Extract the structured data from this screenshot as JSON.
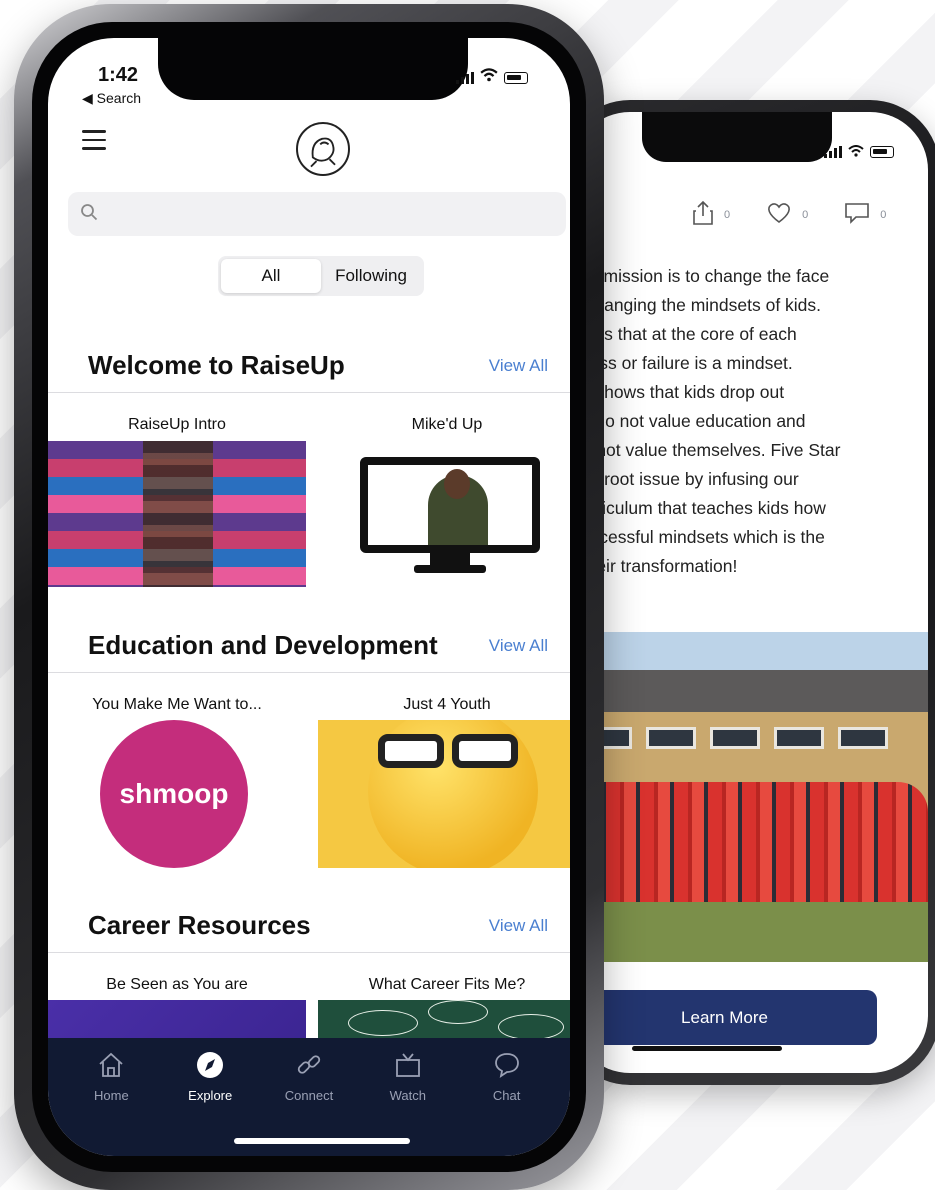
{
  "front": {
    "status": {
      "time": "1:42",
      "back_label": "◀ Search"
    },
    "search": {
      "placeholder": ""
    },
    "segmented": {
      "all": "All",
      "following": "Following"
    },
    "sections": [
      {
        "title": "Welcome to RaiseUp",
        "view_all": "View All",
        "items": [
          {
            "label": "RaiseUp Intro"
          },
          {
            "label": "Mike'd Up"
          }
        ]
      },
      {
        "title": "Education and Development",
        "view_all": "View All",
        "items": [
          {
            "label": "You Make Me Want to..."
          },
          {
            "label": "Just 4 Youth"
          }
        ]
      },
      {
        "title": "Career Resources",
        "view_all": "View All",
        "items": [
          {
            "label": "Be Seen as You are"
          },
          {
            "label": "What Career Fits Me?"
          }
        ]
      }
    ],
    "thumb_text": {
      "shmoop": "shmoop"
    },
    "tabbar": [
      {
        "label": "Home",
        "icon": "home-icon"
      },
      {
        "label": "Explore",
        "icon": "compass-icon",
        "active": true
      },
      {
        "label": "Connect",
        "icon": "link-icon"
      },
      {
        "label": "Watch",
        "icon": "tv-icon"
      },
      {
        "label": "Chat",
        "icon": "chat-icon"
      }
    ]
  },
  "back": {
    "counts": {
      "share": "0",
      "like": "0",
      "comment": "0"
    },
    "text_lines": [
      "fe's mission is to change the face",
      "y changing the mindsets of kids.",
      "hows that at the core of each",
      "ccess or failure is a mindset.",
      "so shows that kids drop out",
      "ey do not value education and",
      "do not value themselves. Five Star",
      "this root issue by infusing our",
      "curriculum that teaches kids how",
      "successful mindsets which is the",
      "f their transformation!"
    ],
    "button": "Learn More"
  },
  "colors": {
    "tabbar_bg": "#111a33",
    "view_all": "#4a7fd0",
    "button_bg": "#23356f",
    "shmoop": "#c42d7c"
  }
}
